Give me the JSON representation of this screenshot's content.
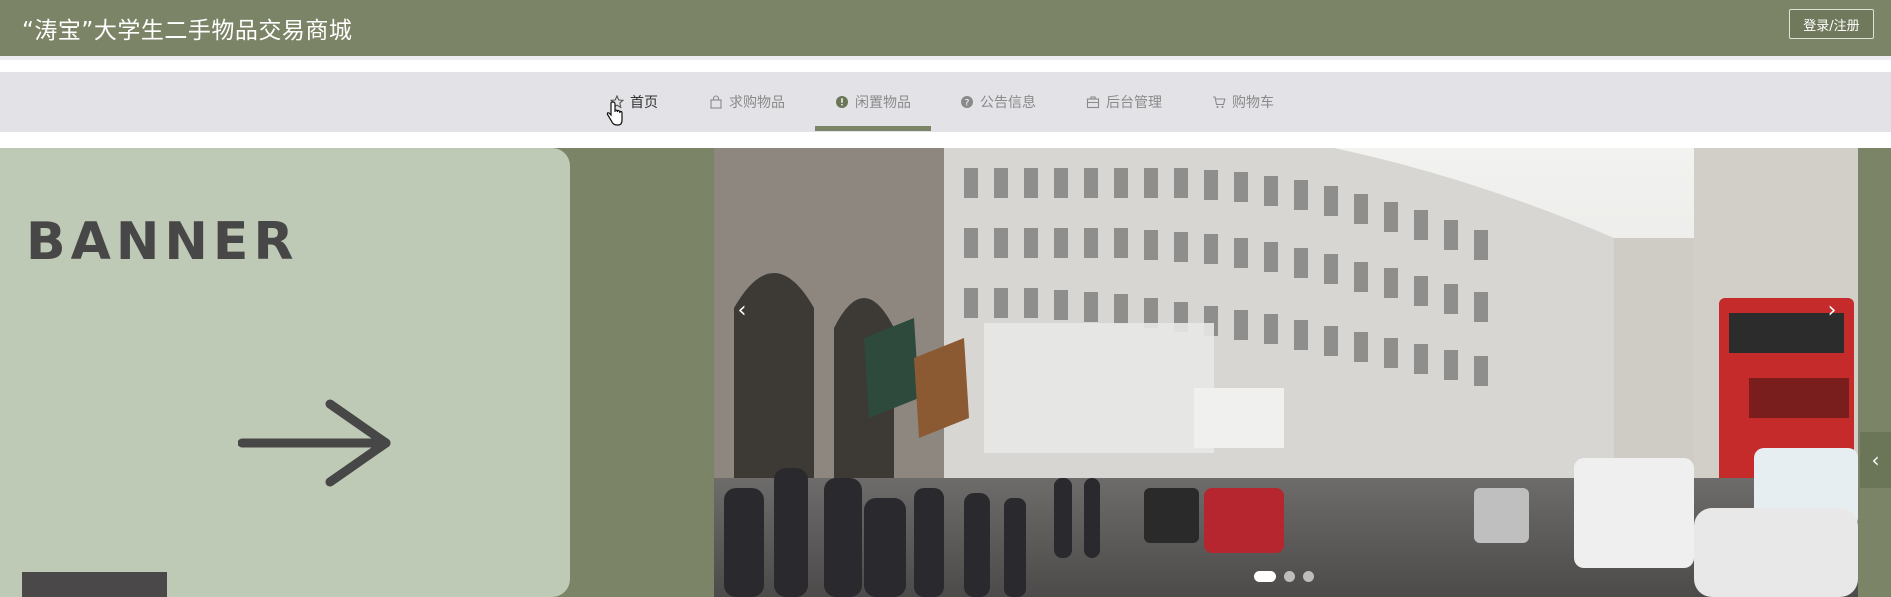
{
  "header": {
    "site_title": "“涛宝”大学生二手物品交易商城",
    "login_label": "登录/注册"
  },
  "nav": {
    "items": [
      {
        "label": "首页",
        "icon": "star-icon"
      },
      {
        "label": "求购物品",
        "icon": "bag-icon"
      },
      {
        "label": "闲置物品",
        "icon": "alert-circle-icon"
      },
      {
        "label": "公告信息",
        "icon": "question-circle-icon"
      },
      {
        "label": "后台管理",
        "icon": "briefcase-icon"
      },
      {
        "label": "购物车",
        "icon": "cart-icon"
      }
    ],
    "active_index": 2
  },
  "banner": {
    "card_text": "BANNER",
    "prev_label": "‹",
    "next_label": "›",
    "slides_count": 3,
    "active_slide": 0,
    "side_tab_label": "‹"
  },
  "colors": {
    "brand": "#7b8466",
    "nav_bg": "#e3e2e6",
    "banner_card": "#bfcab6"
  }
}
